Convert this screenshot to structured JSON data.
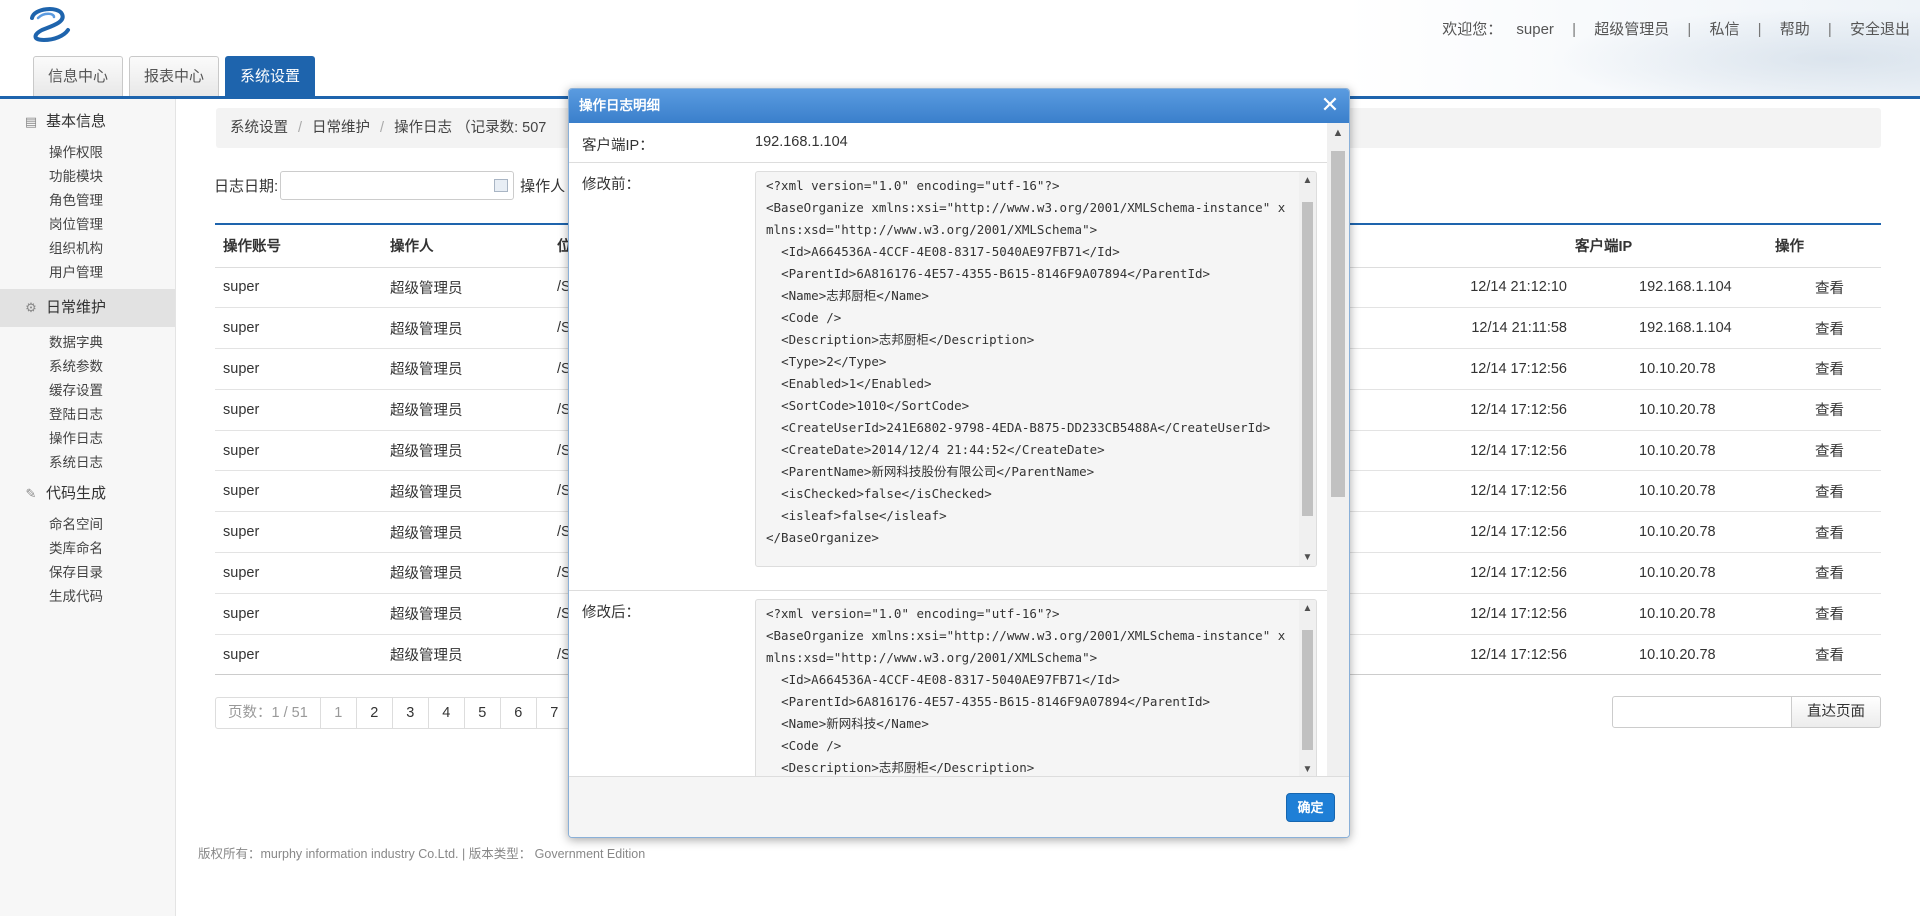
{
  "header": {
    "welcome": "欢迎您：",
    "username": "super",
    "role": "超级管理员",
    "messages": "私信",
    "help": "帮助",
    "logout": "安全退出",
    "separator": "|"
  },
  "tabs": [
    "信息中心",
    "报表中心",
    "系统设置"
  ],
  "sidebar": {
    "groups": [
      {
        "label": "基本信息",
        "icon": "list-icon",
        "items": [
          "操作权限",
          "功能模块",
          "角色管理",
          "岗位管理",
          "组织机构",
          "用户管理"
        ]
      },
      {
        "label": "日常维护",
        "icon": "gear-icon",
        "items": [
          "数据字典",
          "系统参数",
          "缓存设置",
          "登陆日志",
          "操作日志",
          "系统日志"
        ]
      },
      {
        "label": "代码生成",
        "icon": "pencil-icon",
        "items": [
          "命名空间",
          "类库命名",
          "保存目录",
          "生成代码"
        ]
      }
    ]
  },
  "breadcrumb": {
    "items": [
      "系统设置",
      "日常维护",
      "操作日志 （记录数: 507"
    ],
    "separator": "/"
  },
  "filter": {
    "date_label": "日志日期:",
    "operator_label": "操作人"
  },
  "table": {
    "headers": [
      "操作账号",
      "操作人",
      "位",
      "",
      "",
      "",
      "",
      "",
      "客户端IP",
      "操作"
    ],
    "rows": [
      {
        "account": "super",
        "operator": "超级管理员",
        "loc": "/S",
        "time": "12/14 21:12:10",
        "ip": "192.168.1.104",
        "action": "查看"
      },
      {
        "account": "super",
        "operator": "超级管理员",
        "loc": "/S",
        "time": "12/14 21:11:58",
        "ip": "192.168.1.104",
        "action": "查看"
      },
      {
        "account": "super",
        "operator": "超级管理员",
        "loc": "/S",
        "time": "12/14 17:12:56",
        "ip": "10.10.20.78",
        "action": "查看"
      },
      {
        "account": "super",
        "operator": "超级管理员",
        "loc": "/S",
        "time": "12/14 17:12:56",
        "ip": "10.10.20.78",
        "action": "查看"
      },
      {
        "account": "super",
        "operator": "超级管理员",
        "loc": "/S",
        "time": "12/14 17:12:56",
        "ip": "10.10.20.78",
        "action": "查看"
      },
      {
        "account": "super",
        "operator": "超级管理员",
        "loc": "/S",
        "time": "12/14 17:12:56",
        "ip": "10.10.20.78",
        "action": "查看"
      },
      {
        "account": "super",
        "operator": "超级管理员",
        "loc": "/S",
        "time": "12/14 17:12:56",
        "ip": "10.10.20.78",
        "action": "查看"
      },
      {
        "account": "super",
        "operator": "超级管理员",
        "loc": "/S",
        "time": "12/14 17:12:56",
        "ip": "10.10.20.78",
        "action": "查看"
      },
      {
        "account": "super",
        "operator": "超级管理员",
        "loc": "/S",
        "time": "12/14 17:12:56",
        "ip": "10.10.20.78",
        "action": "查看"
      },
      {
        "account": "super",
        "operator": "超级管理员",
        "loc": "/S",
        "time": "12/14 17:12:56",
        "ip": "10.10.20.78",
        "action": "查看"
      }
    ]
  },
  "pager": {
    "info": "页数：1 / 51",
    "pages": [
      "1",
      "2",
      "3",
      "4",
      "5",
      "6",
      "7"
    ],
    "goto_label": "直达页面"
  },
  "footer": {
    "copyright": "版权所有：murphy information industry Co.Ltd. | 版本类型： Government Edition"
  },
  "dialog": {
    "title": "操作日志明细",
    "client_ip_label": "客户端IP：",
    "client_ip": "192.168.1.104",
    "before_label": "修改前：",
    "before_xml": "<?xml version=\"1.0\" encoding=\"utf-16\"?>\n<BaseOrganize xmlns:xsi=\"http://www.w3.org/2001/XMLSchema-instance\" xmlns:xsd=\"http://www.w3.org/2001/XMLSchema\">\n  <Id>A664536A-4CCF-4E08-8317-5040AE97FB71</Id>\n  <ParentId>6A816176-4E57-4355-B615-8146F9A07894</ParentId>\n  <Name>志邦厨柜</Name>\n  <Code />\n  <Description>志邦厨柜</Description>\n  <Type>2</Type>\n  <Enabled>1</Enabled>\n  <SortCode>1010</SortCode>\n  <CreateUserId>241E6802-9798-4EDA-B875-DD233CB5488A</CreateUserId>\n  <CreateDate>2014/12/4 21:44:52</CreateDate>\n  <ParentName>新网科技股份有限公司</ParentName>\n  <isChecked>false</isChecked>\n  <isleaf>false</isleaf>\n</BaseOrganize>",
    "after_label": "修改后：",
    "after_xml": "<?xml version=\"1.0\" encoding=\"utf-16\"?>\n<BaseOrganize xmlns:xsi=\"http://www.w3.org/2001/XMLSchema-instance\" xmlns:xsd=\"http://www.w3.org/2001/XMLSchema\">\n  <Id>A664536A-4CCF-4E08-8317-5040AE97FB71</Id>\n  <ParentId>6A816176-4E57-4355-B615-8146F9A07894</ParentId>\n  <Name>新网科技</Name>\n  <Code />\n  <Description>志邦厨柜</Description>",
    "ok_label": "确定",
    "close_glyph": "✕"
  },
  "colors": {
    "accent": "#1e64ad",
    "dialog_header": "#4a8ed8",
    "ok_button": "#1f7fd6"
  }
}
